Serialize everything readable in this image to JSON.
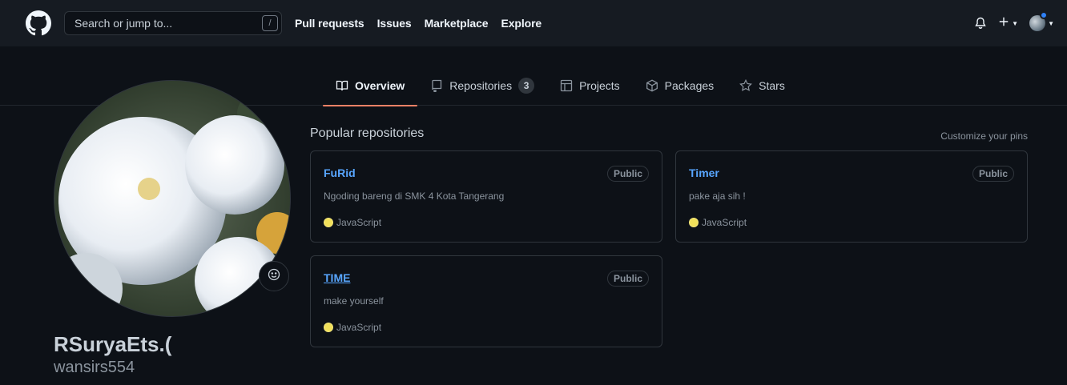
{
  "header": {
    "search_placeholder": "Search or jump to...",
    "search_shortcut": "/",
    "nav": [
      "Pull requests",
      "Issues",
      "Marketplace",
      "Explore"
    ],
    "right_icons": [
      "bell-icon",
      "plus-icon",
      "avatar"
    ]
  },
  "tabs": [
    {
      "label": "Overview",
      "icon": "book-icon",
      "active": true
    },
    {
      "label": "Repositories",
      "icon": "repo-icon",
      "count": "3"
    },
    {
      "label": "Projects",
      "icon": "table-icon"
    },
    {
      "label": "Packages",
      "icon": "package-icon"
    },
    {
      "label": "Stars",
      "icon": "star-icon"
    }
  ],
  "profile": {
    "full_name": "RSuryaEts.(",
    "login": "wansirs554"
  },
  "popular": {
    "title": "Popular repositories",
    "customize": "Customize your pins",
    "repos": [
      {
        "name": "FuRid",
        "visibility": "Public",
        "description": "Ngoding bareng di SMK 4 Kota Tangerang",
        "language": "JavaScript",
        "lang_color": "#f1e05a"
      },
      {
        "name": "Timer",
        "visibility": "Public",
        "description": "pake aja sih !",
        "language": "JavaScript",
        "lang_color": "#f1e05a"
      },
      {
        "name": "TIME",
        "visibility": "Public",
        "description": "make yourself",
        "language": "JavaScript",
        "lang_color": "#f1e05a"
      }
    ]
  },
  "colors": {
    "background": "#0d1117",
    "header": "#161b22",
    "link": "#58a6ff",
    "tab_underline": "#f78166"
  }
}
